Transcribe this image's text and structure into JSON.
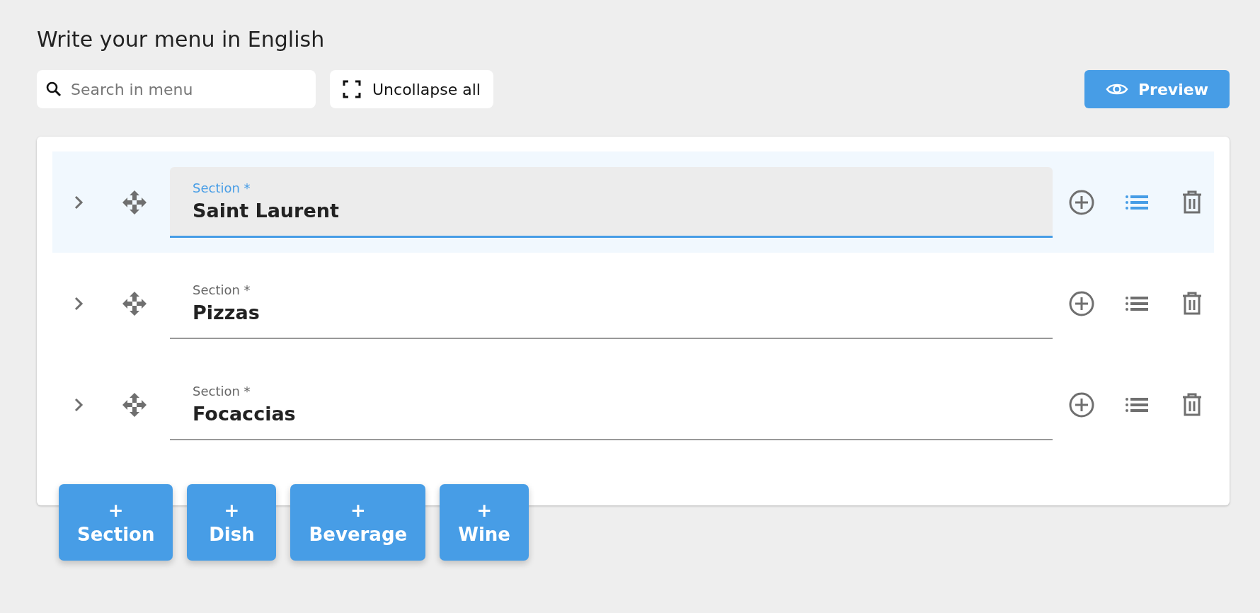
{
  "title": "Write your menu in English",
  "toolbar": {
    "search": {
      "placeholder": "Search in menu"
    },
    "uncollapse": "Uncollapse all",
    "preview": "Preview"
  },
  "sections": [
    {
      "label": "Section *",
      "value": "Saint Laurent",
      "focused": true
    },
    {
      "label": "Section *",
      "value": "Pizzas",
      "focused": false
    },
    {
      "label": "Section *",
      "value": "Focaccias",
      "focused": false
    }
  ],
  "add_buttons": [
    {
      "icon": "+",
      "label": "Section"
    },
    {
      "icon": "+",
      "label": "Dish"
    },
    {
      "icon": "+",
      "label": "Beverage"
    },
    {
      "icon": "+",
      "label": "Wine"
    }
  ]
}
